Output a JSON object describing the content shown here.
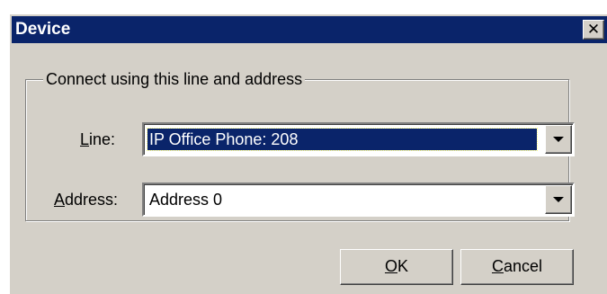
{
  "window": {
    "title": "Device",
    "close_glyph": "✕"
  },
  "group": {
    "legend": "Connect using this line and address"
  },
  "line_field": {
    "label_mnemonic": "L",
    "label_rest": "ine:",
    "value": "IP Office Phone: 208"
  },
  "address_field": {
    "label_mnemonic": "A",
    "label_rest": "ddress:",
    "value": "Address 0"
  },
  "buttons": {
    "ok_mnemonic": "O",
    "ok_rest": "K",
    "cancel_mnemonic": "C",
    "cancel_rest": "ancel"
  },
  "colors": {
    "titlebar": "#0a246a",
    "face": "#d4d0c8",
    "selection": "#0a246a"
  },
  "icons": {
    "close": "close-icon",
    "dropdown": "chevron-down-icon"
  }
}
